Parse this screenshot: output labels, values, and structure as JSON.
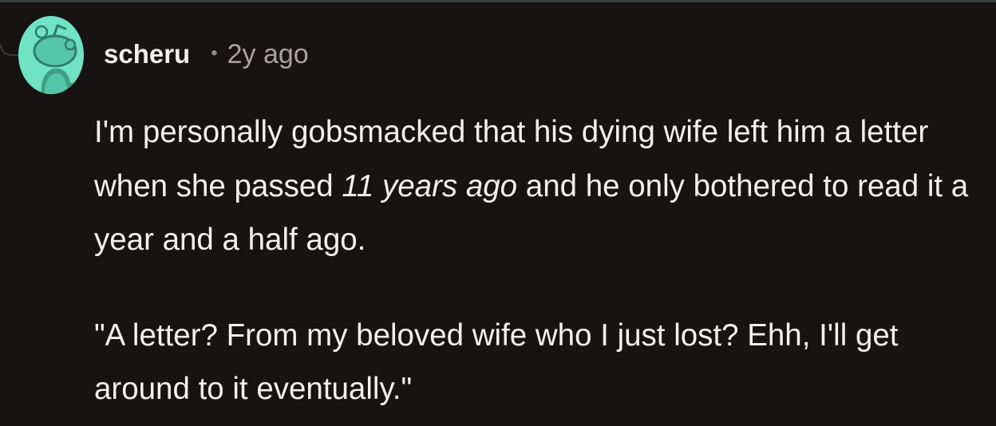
{
  "comment": {
    "author": "scheru",
    "separator": "•",
    "timestamp": "2y ago",
    "avatar_icon": "reddit-snoo-avatar-icon",
    "avatar_color": "#6fe3c4",
    "paragraph1": {
      "before": "I'm personally gobsmacked that his dying wife left him a letter when she passed ",
      "emphasis": "11 years ago",
      "after": " and he only bothered to read it a year and a half ago."
    },
    "paragraph2": "\"A letter? From my beloved wife who I just lost? Ehh, I'll get around to it eventually.\""
  }
}
